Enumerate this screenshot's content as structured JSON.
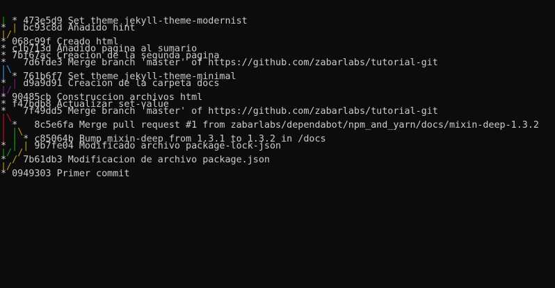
{
  "colors": {
    "background": "#0c0c0c",
    "foreground": "#cccccc",
    "graph_green": "#13a10e",
    "graph_orange": "#c19c00",
    "graph_blue": "#3a96dd",
    "graph_purple": "#881798",
    "graph_red": "#c50f1f"
  },
  "lines": [
    [
      {
        "t": "| ",
        "c": "graph_green"
      },
      {
        "t": "* 473e5d9 Set theme jekyll-theme-modernist",
        "c": "foreground"
      }
    ],
    [
      {
        "t": "* ",
        "c": "foreground"
      },
      {
        "t": "| ",
        "c": "graph_orange"
      },
      {
        "t": "bc93c8d Añadido hint",
        "c": "foreground"
      }
    ],
    [
      {
        "t": "|/",
        "c": "graph_orange"
      }
    ],
    [
      {
        "t": "* 068c99f Creado html",
        "c": "foreground"
      }
    ],
    [
      {
        "t": "* c1b713d Añadido pagina al sumario",
        "c": "foreground"
      }
    ],
    [
      {
        "t": "* 7bf67ac Creacion de la segunda pagina",
        "c": "foreground"
      }
    ],
    [
      {
        "t": "*   7d6fde3 Merge branch 'master' of https://github.com/zabarlabs/tutorial-git",
        "c": "foreground"
      }
    ],
    [
      {
        "t": "|\\",
        "c": "graph_blue"
      }
    ],
    [
      {
        "t": "| ",
        "c": "graph_blue"
      },
      {
        "t": "* 761b6f7 Set theme jekyll-theme-minimal",
        "c": "foreground"
      }
    ],
    [
      {
        "t": "* ",
        "c": "foreground"
      },
      {
        "t": "| ",
        "c": "graph_purple"
      },
      {
        "t": "d9a9d91 Creacion de la carpeta docs",
        "c": "foreground"
      }
    ],
    [
      {
        "t": "|/",
        "c": "graph_purple"
      }
    ],
    [
      {
        "t": "* 90485cb Construccion archivos html",
        "c": "foreground"
      }
    ],
    [
      {
        "t": "* f47bdb8 Actualizar set-value",
        "c": "foreground"
      }
    ],
    [
      {
        "t": "*   7f49dd5 Merge branch 'master' of https://github.com/zabarlabs/tutorial-git",
        "c": "foreground"
      }
    ],
    [
      {
        "t": "|\\",
        "c": "graph_red"
      }
    ],
    [
      {
        "t": "| ",
        "c": "graph_red"
      },
      {
        "t": "*   8c5e6fa Merge pull request #1 from zabarlabs/dependabot/npm_and_yarn/docs/mixin-deep-1.3.2",
        "c": "foreground"
      }
    ],
    [
      {
        "t": "| ",
        "c": "graph_red"
      },
      {
        "t": "|",
        "c": "graph_green"
      },
      {
        "t": "\\",
        "c": "graph_orange"
      }
    ],
    [
      {
        "t": "| ",
        "c": "graph_red"
      },
      {
        "t": "| ",
        "c": "graph_green"
      },
      {
        "t": "* c85064b Bump mixin-deep from 1.3.1 to 1.3.2 in /docs",
        "c": "foreground"
      }
    ],
    [
      {
        "t": "* ",
        "c": "foreground"
      },
      {
        "t": "| ",
        "c": "graph_green"
      },
      {
        "t": "| ",
        "c": "graph_orange"
      },
      {
        "t": "9b7fe04 Modificado archivo package-lock-json",
        "c": "foreground"
      }
    ],
    [
      {
        "t": "|/ ",
        "c": "graph_green"
      },
      {
        "t": "/",
        "c": "graph_orange"
      }
    ],
    [
      {
        "t": "* ",
        "c": "foreground"
      },
      {
        "t": "/ ",
        "c": "graph_orange"
      },
      {
        "t": "7b61db3 Modificacion de archivo package.json",
        "c": "foreground"
      }
    ],
    [
      {
        "t": "|/",
        "c": "graph_orange"
      }
    ],
    [
      {
        "t": "* 0949303 Primer commit",
        "c": "foreground"
      }
    ]
  ]
}
